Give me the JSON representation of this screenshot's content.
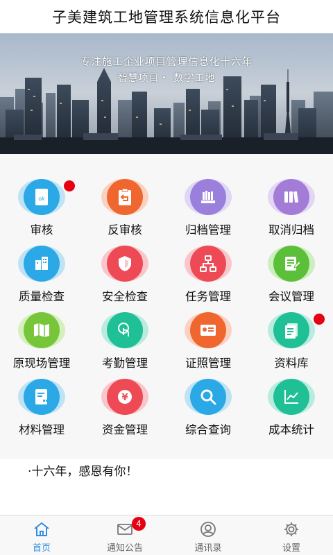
{
  "header": {
    "title": "子美建筑工地管理系统信息化平台"
  },
  "banner": {
    "line1": "专注施工企业项目管理信息化十六年",
    "line2": "智慧项目・ 数字工地"
  },
  "grid": [
    {
      "label": "审核",
      "icon": "ok-document-icon",
      "color": "#2aa9e6",
      "badge_dot": true
    },
    {
      "label": "反审核",
      "icon": "return-clipboard-icon",
      "color": "#f0662f",
      "badge_dot": false
    },
    {
      "label": "归档管理",
      "icon": "archive-books-icon",
      "color": "#9a7fdc",
      "badge_dot": false
    },
    {
      "label": "取消归档",
      "icon": "binders-icon",
      "color": "#a37cd8",
      "badge_dot": false
    },
    {
      "label": "质量检查",
      "icon": "buildings-icon",
      "color": "#2aa9e6",
      "badge_dot": false
    },
    {
      "label": "安全检查",
      "icon": "shield-icon",
      "color": "#ee4a55",
      "badge_dot": false
    },
    {
      "label": "任务管理",
      "icon": "flowchart-icon",
      "color": "#ee4a55",
      "badge_dot": false
    },
    {
      "label": "会议管理",
      "icon": "meeting-note-icon",
      "color": "#5cbf3a",
      "badge_dot": true
    },
    {
      "label": "原现场管理",
      "icon": "map-icon",
      "color": "#77c63a",
      "badge_dot": false
    },
    {
      "label": "考勤管理",
      "icon": "touch-icon",
      "color": "#1fc096",
      "badge_dot": false
    },
    {
      "label": "证照管理",
      "icon": "certificate-icon",
      "color": "#f0662f",
      "badge_dot": false
    },
    {
      "label": "资料库",
      "icon": "documents-icon",
      "color": "#1fc096",
      "badge_dot": false
    },
    {
      "label": "材料管理",
      "icon": "material-list-icon",
      "color": "#2aa9e6",
      "badge_dot": false
    },
    {
      "label": "资金管理",
      "icon": "yen-icon",
      "color": "#ee4a55",
      "badge_dot": false
    },
    {
      "label": "综合查询",
      "icon": "magnifier-icon",
      "color": "#2aa9e6",
      "badge_dot": false
    },
    {
      "label": "成本统计",
      "icon": "line-chart-icon",
      "color": "#1fc096",
      "badge_dot": false
    }
  ],
  "notice": {
    "text": "·十六年，感恩有你！"
  },
  "nav": {
    "items": [
      {
        "label": "首页",
        "icon": "home-icon",
        "active": true
      },
      {
        "label": "通知公告",
        "icon": "mail-icon",
        "badge": "4"
      },
      {
        "label": "通讯录",
        "icon": "contacts-icon"
      },
      {
        "label": "设置",
        "icon": "gear-icon"
      }
    ]
  },
  "colors": {
    "accent": "#2f8fe0",
    "badge": "#e60012"
  }
}
